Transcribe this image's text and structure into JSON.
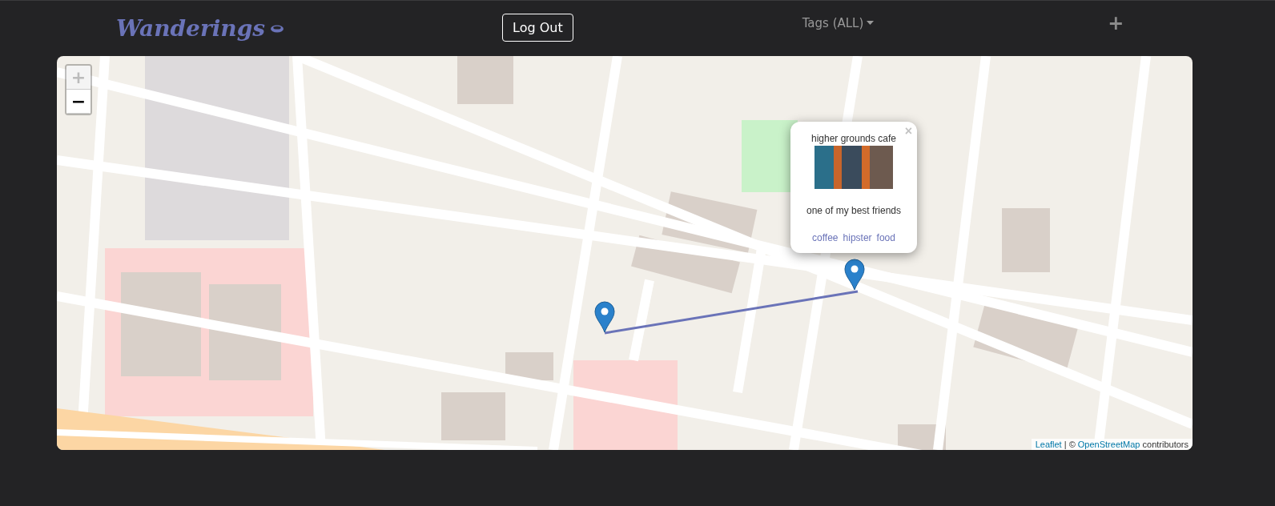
{
  "header": {
    "logo": "Wanderings",
    "logout_button": "Log Out",
    "tags_dropdown": "Tags (ALL)",
    "add_button": "+"
  },
  "map": {
    "zoom_controls": [
      {
        "label": "+",
        "disabled": true
      },
      {
        "label": "−",
        "disabled": false
      }
    ],
    "popup": {
      "title": "higher grounds cafe",
      "description": "one of my best friends",
      "tags": [
        "coffee",
        "hipster",
        "food"
      ],
      "close": "×"
    },
    "attribution": {
      "leaflet_link": "Leaflet",
      "separator": "| ©",
      "osm_link": "OpenStreetMap",
      "suffix": "contributors"
    }
  }
}
